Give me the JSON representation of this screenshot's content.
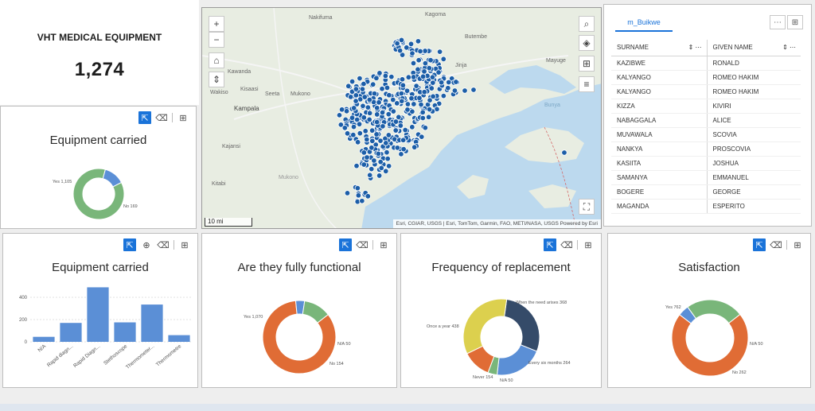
{
  "kpi": {
    "title": "VHT MEDICAL EQUIPMENT",
    "value": "1,274"
  },
  "map": {
    "zoom_in": "+",
    "zoom_out": "−",
    "scale": "10 mi",
    "attribution": "Esri, CGIAR, USGS | Esri, TomTom, Garmin, FAO, METI/NASA, USGS   Powered by Esri",
    "place_labels": [
      "Nakifuma",
      "Kagoma",
      "Butembe",
      "Jinja",
      "Mayuge",
      "Kawanda",
      "Wakiso",
      "Kisaasi",
      "Seeta",
      "Mukono",
      "Kampala",
      "Kajansi",
      "Kitabi",
      "Mukono",
      "Bunya"
    ],
    "point_color": "#1c5ea8"
  },
  "table": {
    "tab_label": "m_Buikwe",
    "columns": [
      "SURNAME",
      "GIVEN NAME"
    ],
    "rows": [
      [
        "KAZIBWE",
        "RONALD"
      ],
      [
        "KALYANGO",
        "ROMEO HAKIM"
      ],
      [
        "KALYANGO",
        "ROMEO HAKIM"
      ],
      [
        "KIZZA",
        "KIVIRI"
      ],
      [
        "NABAGGALA",
        "ALICE"
      ],
      [
        "MUVAWALA",
        "SCOVIA"
      ],
      [
        "NANKYA",
        "PROSCOVIA"
      ],
      [
        "KASIITA",
        "JOSHUA"
      ],
      [
        "SAMANYA",
        "EMMANUEL"
      ],
      [
        "BOGERE",
        "GEORGE"
      ],
      [
        "MAGANDA",
        "ESPERITO"
      ]
    ]
  },
  "colors": {
    "accent": "#1a73d9",
    "green": "#79b67a",
    "blue": "#5b8fd6",
    "orange": "#e06c35",
    "yellow": "#dcd04e",
    "navy": "#354b69",
    "bar": "#5b8fd6"
  },
  "chart_data": [
    {
      "type": "pie",
      "title": "Equipment carried",
      "donut": true,
      "slices": [
        {
          "label": "Yes",
          "value": 1105
        },
        {
          "label": "No",
          "value": 169
        }
      ],
      "slice_labels": [
        "Yes 1,105",
        "No 169"
      ]
    },
    {
      "type": "bar",
      "title": "Equipment carried",
      "categories": [
        "N/A",
        "Rapid diagn...",
        "Rapid Diagn...",
        "Stethoscope",
        "Thermometer...",
        "Thermometre"
      ],
      "values": [
        45,
        170,
        490,
        175,
        335,
        60
      ],
      "ylim": [
        0,
        500
      ],
      "yticks": [
        "0",
        "200",
        "400"
      ]
    },
    {
      "type": "pie",
      "title": "Are they fully functional",
      "donut": true,
      "slices": [
        {
          "label": "Yes",
          "value": 1070
        },
        {
          "label": "N/A",
          "value": 50
        },
        {
          "label": "No",
          "value": 154
        }
      ],
      "slice_labels": [
        "Yes 1,070",
        "N/A 50",
        "No 154"
      ]
    },
    {
      "type": "pie",
      "title": "Frequency of replacement",
      "donut": true,
      "slices": [
        {
          "label": "When the need arises",
          "value": 368
        },
        {
          "label": "Every six months",
          "value": 264
        },
        {
          "label": "N/A",
          "value": 50
        },
        {
          "label": "Never",
          "value": 154
        },
        {
          "label": "Once a year",
          "value": 438
        }
      ],
      "slice_labels": [
        "When the need arises 368",
        "Every six months 264",
        "N/A 50",
        "Never 154",
        "Once a year 438"
      ]
    },
    {
      "type": "pie",
      "title": "Satisfaction",
      "donut": true,
      "slices": [
        {
          "label": "Yes",
          "value": 762
        },
        {
          "label": "N/A",
          "value": 50
        },
        {
          "label": "No",
          "value": 262
        }
      ],
      "slice_labels": [
        "Yes 762",
        "N/A 50",
        "No 262"
      ]
    }
  ]
}
